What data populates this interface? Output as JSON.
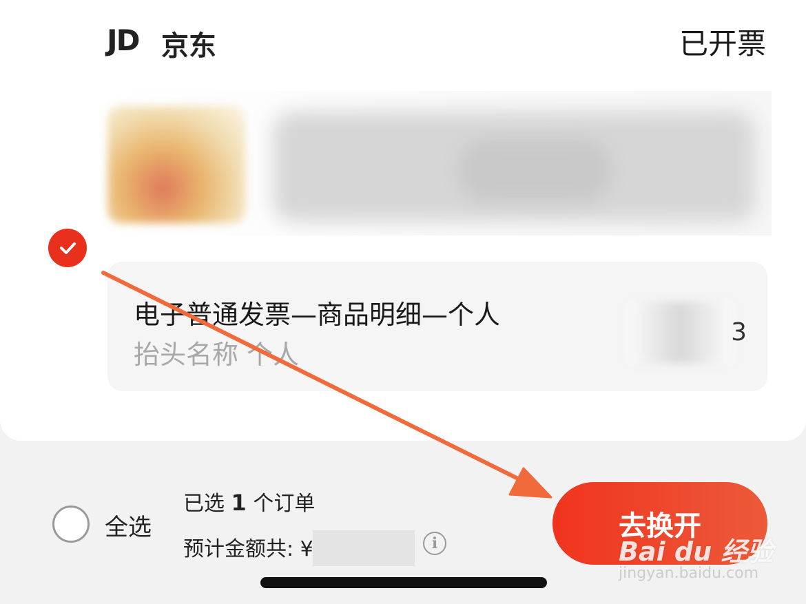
{
  "order_card": {
    "shop_logo": "JD",
    "shop_name": "京东",
    "invoice_status": "已开票",
    "selected": true,
    "invoice": {
      "type_text": "电子普通发票—商品明细—个人",
      "title_text": "抬头名称 个人",
      "amount_tail": "3"
    }
  },
  "footer": {
    "select_all_label": "全选",
    "selected_prefix": "已选",
    "selected_count": "1",
    "selected_suffix": "个订单",
    "estimate_label": "预计金额共: ¥",
    "info_icon_text": "i",
    "reissue_button_label": "去换开"
  },
  "watermark": {
    "logo_text": "Bai du 经验",
    "url": "jingyan.baidu.com"
  },
  "colors": {
    "accent": "#e8301c",
    "arrow": "#f06a3c"
  },
  "icons": {
    "check": "check-circle-icon",
    "radio": "radio-unchecked-icon",
    "info": "info-icon"
  }
}
